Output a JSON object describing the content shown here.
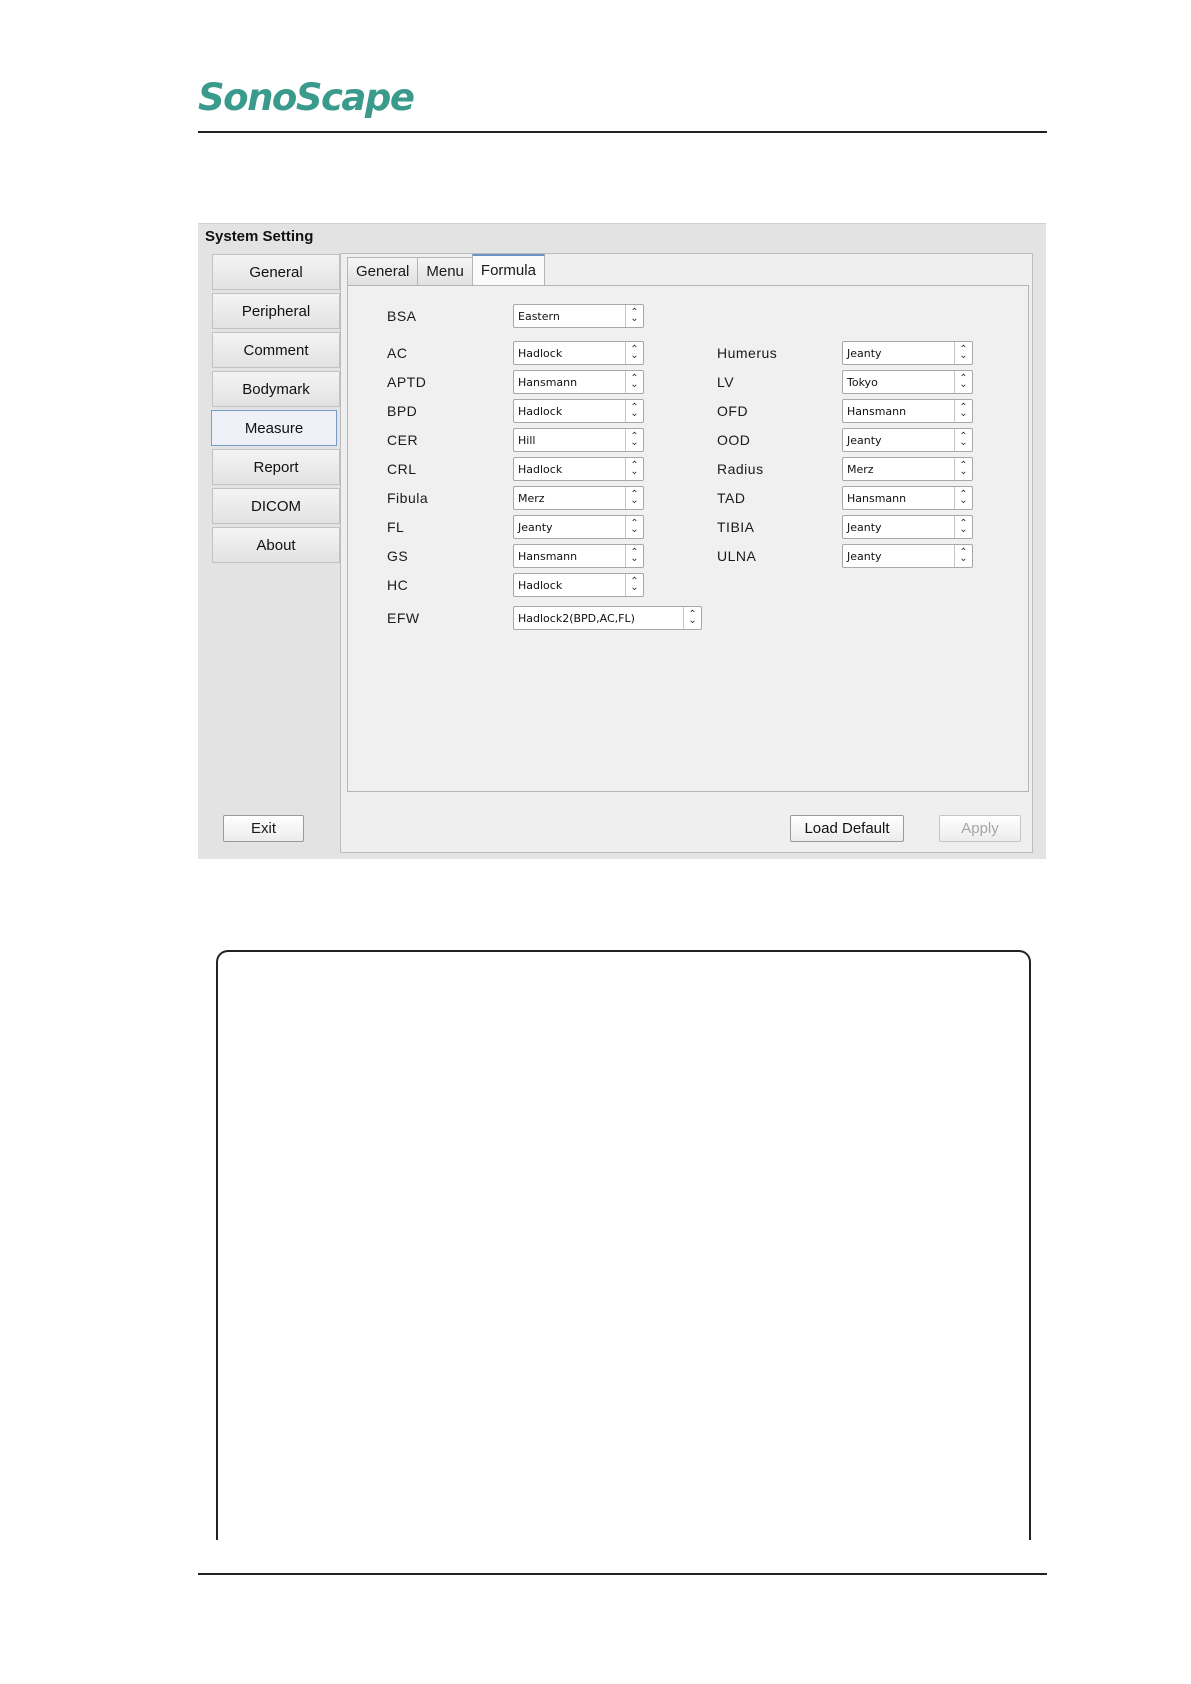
{
  "logo": {
    "text": "SonoScape"
  },
  "window": {
    "title": "System Setting"
  },
  "sidebar": {
    "items": [
      {
        "label": "General"
      },
      {
        "label": "Peripheral"
      },
      {
        "label": "Comment"
      },
      {
        "label": "Bodymark"
      },
      {
        "label": "Measure",
        "active": true
      },
      {
        "label": "Report"
      },
      {
        "label": "DICOM"
      },
      {
        "label": "About"
      }
    ],
    "exit_label": "Exit"
  },
  "tabs": [
    {
      "label": "General"
    },
    {
      "label": "Menu"
    },
    {
      "label": "Formula",
      "active": true
    }
  ],
  "formula": {
    "bsa": {
      "label": "BSA",
      "value": "Eastern"
    },
    "left": [
      {
        "label": "AC",
        "value": "Hadlock"
      },
      {
        "label": "APTD",
        "value": "Hansmann"
      },
      {
        "label": "BPD",
        "value": "Hadlock"
      },
      {
        "label": "CER",
        "value": "Hill"
      },
      {
        "label": "CRL",
        "value": "Hadlock"
      },
      {
        "label": "Fibula",
        "value": "Merz"
      },
      {
        "label": "FL",
        "value": "Jeanty"
      },
      {
        "label": "GS",
        "value": "Hansmann"
      },
      {
        "label": "HC",
        "value": "Hadlock"
      }
    ],
    "right": [
      {
        "label": "Humerus",
        "value": "Jeanty"
      },
      {
        "label": "LV",
        "value": "Tokyo"
      },
      {
        "label": "OFD",
        "value": "Hansmann"
      },
      {
        "label": "OOD",
        "value": "Jeanty"
      },
      {
        "label": "Radius",
        "value": "Merz"
      },
      {
        "label": "TAD",
        "value": "Hansmann"
      },
      {
        "label": "TIBIA",
        "value": "Jeanty"
      },
      {
        "label": "ULNA",
        "value": "Jeanty"
      }
    ],
    "efw": {
      "label": "EFW",
      "value": "Hadlock2(BPD,AC,FL)"
    }
  },
  "buttons": {
    "load_default": "Load Default",
    "apply": "Apply"
  },
  "colors": {
    "brand": "#3a9a8c",
    "active_tab_accent": "#6c93c6"
  }
}
